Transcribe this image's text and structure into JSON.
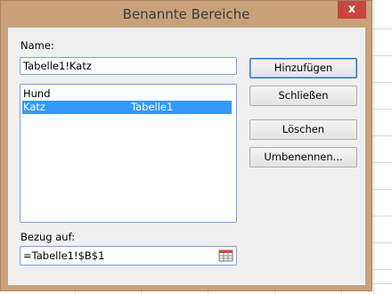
{
  "dialog": {
    "title": "Benannte Bereiche",
    "close_glyph": "x"
  },
  "name_label": "Name:",
  "name_value": "Tabelle1!Katz",
  "names_list": [
    {
      "name": "Hund",
      "ref": "",
      "selected": false
    },
    {
      "name": "Katz",
      "ref": "Tabelle1",
      "selected": true
    }
  ],
  "buttons": {
    "add": "Hinzufügen",
    "close": "Schließen",
    "delete": "Löschen",
    "rename": "Umbenennen..."
  },
  "ref_label": "Bezug auf:",
  "ref_value": "=Tabelle1!$B$1",
  "colors": {
    "dialog_frame": "#c8a27b",
    "selection": "#3399ff",
    "close_button": "#c7463f"
  },
  "icons": {
    "ref_picker": "range-select-icon"
  }
}
